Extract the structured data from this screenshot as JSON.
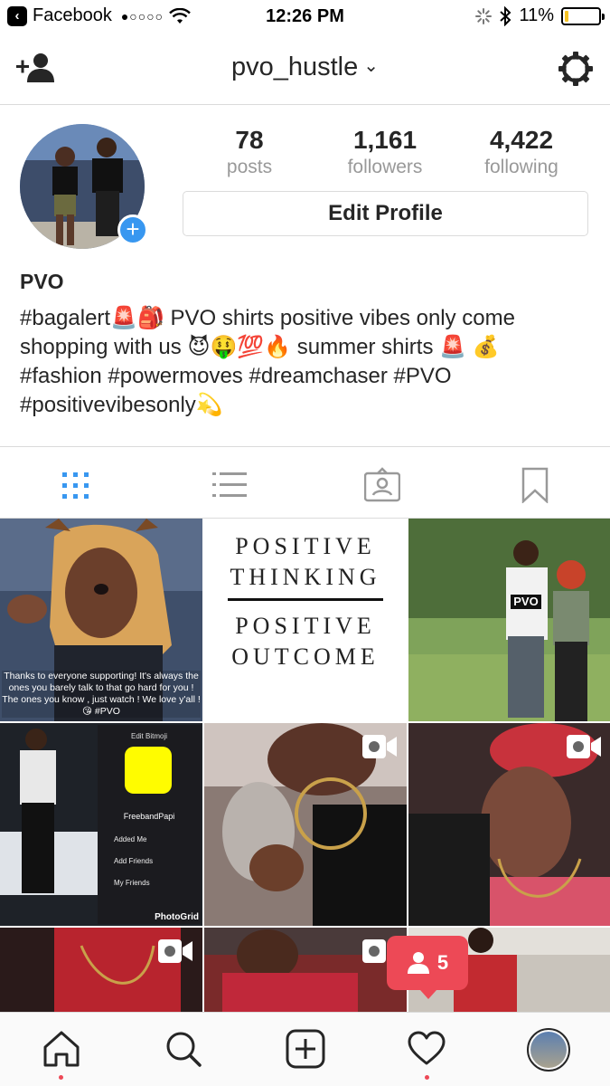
{
  "status_bar": {
    "back_app": "Facebook",
    "signal": "●○○○○",
    "time": "12:26 PM",
    "battery_percent": "11%",
    "battery_level": 0.11
  },
  "header": {
    "username": "pvo_hustle",
    "chevron": "⌄"
  },
  "profile": {
    "stats": [
      {
        "value": "78",
        "label": "posts"
      },
      {
        "value": "1,161",
        "label": "followers"
      },
      {
        "value": "4,422",
        "label": "following"
      }
    ],
    "edit_button": "Edit Profile",
    "name": "PVO",
    "bio_lines": [
      "#bagalert🚨🎒  PVO shirts positive vibes only come",
      "shopping with us 😈🤑💯🔥 summer shirts 🚨 💰",
      "#fashion #powermoves #dreamchaser #PVO",
      "#positivevibesonly💫"
    ]
  },
  "posts": {
    "caption_1": "Thanks to everyone supporting! It's always the ones you barely talk to that go hard for you ! The ones you know , just watch ! We love y'all ! 😘 #PVO",
    "quote_lines": [
      "POSITIVE",
      "THINKING",
      "POSITIVE",
      "OUTCOME"
    ],
    "shirt_text": "PVO",
    "snap": {
      "title": "Edit Bitmoji",
      "name": "FreebandPapi",
      "items": [
        "Added Me",
        "Add Friends",
        "My Friends"
      ],
      "watermark": "PhotoGrid"
    }
  },
  "notifications": {
    "follow_requests": "5"
  },
  "colors": {
    "accent_blue": "#3897f0",
    "notification_red": "#ed4956",
    "battery_yellow": "#f6c325"
  }
}
